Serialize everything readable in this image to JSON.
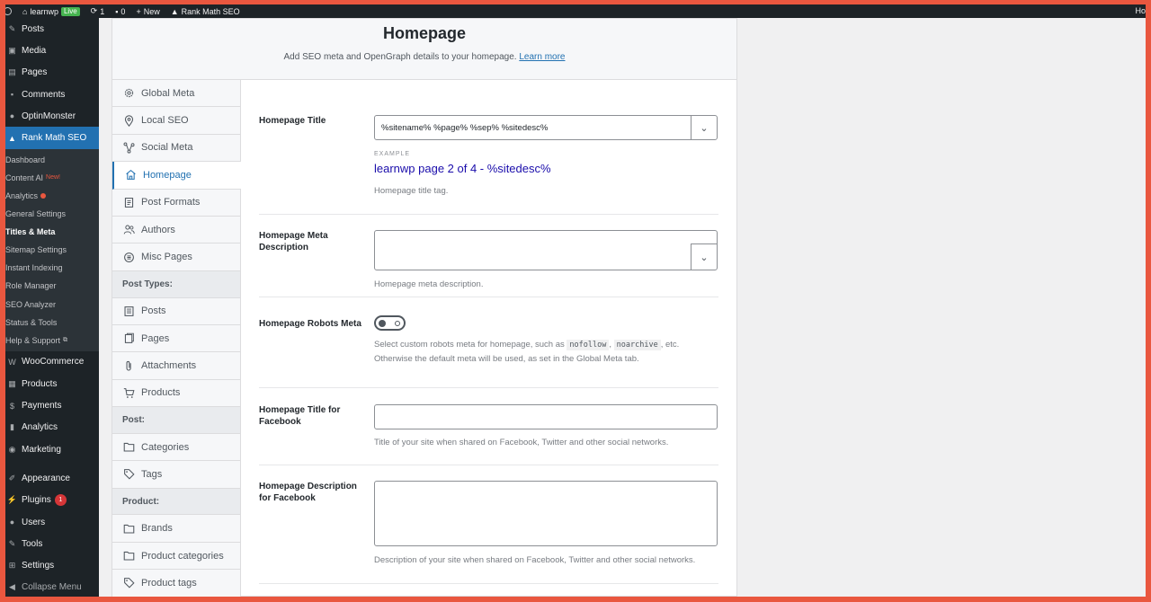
{
  "admin_bar": {
    "site_name": "learnwp",
    "live_badge": "Live",
    "updates_count": "1",
    "comments_count": "0",
    "new_label": "New",
    "plugin_label": "Rank Math SEO",
    "right_text": "Ho"
  },
  "admin_menu": {
    "items_top": [
      {
        "label": "Posts",
        "icon": "pin-icon"
      },
      {
        "label": "Media",
        "icon": "media-icon"
      },
      {
        "label": "Pages",
        "icon": "pages-icon"
      },
      {
        "label": "Comments",
        "icon": "comment-icon"
      },
      {
        "label": "OptinMonster",
        "icon": "optinmonster-icon"
      }
    ],
    "active_item": "Rank Math SEO",
    "submenu": [
      {
        "label": "Dashboard"
      },
      {
        "label": "Content AI",
        "tag": "New!"
      },
      {
        "label": "Analytics"
      },
      {
        "label": "General Settings"
      },
      {
        "label": "Titles & Meta"
      },
      {
        "label": "Sitemap Settings"
      },
      {
        "label": "Instant Indexing"
      },
      {
        "label": "Role Manager"
      },
      {
        "label": "SEO Analyzer"
      },
      {
        "label": "Status & Tools"
      },
      {
        "label": "Help & Support"
      }
    ],
    "items_bottom": [
      {
        "label": "WooCommerce"
      },
      {
        "label": "Products"
      },
      {
        "label": "Payments"
      },
      {
        "label": "Analytics"
      },
      {
        "label": "Marketing"
      }
    ],
    "items_bottom2": [
      {
        "label": "Appearance"
      },
      {
        "label": "Plugins",
        "badge": "1"
      },
      {
        "label": "Users"
      },
      {
        "label": "Tools"
      },
      {
        "label": "Settings"
      },
      {
        "label": "Collapse Menu"
      }
    ]
  },
  "header": {
    "title": "Homepage",
    "subtitle": "Add SEO meta and OpenGraph details to your homepage.",
    "learn_more": "Learn more"
  },
  "tabs": {
    "items": [
      {
        "label": "Global Meta"
      },
      {
        "label": "Local SEO"
      },
      {
        "label": "Social Meta"
      },
      {
        "label": "Homepage"
      },
      {
        "label": "Post Formats"
      },
      {
        "label": "Authors"
      },
      {
        "label": "Misc Pages"
      }
    ],
    "post_types_head": "Post Types:",
    "post_types": [
      {
        "label": "Posts"
      },
      {
        "label": "Pages"
      },
      {
        "label": "Attachments"
      },
      {
        "label": "Products"
      }
    ],
    "post_head": "Post:",
    "post": [
      {
        "label": "Categories"
      },
      {
        "label": "Tags"
      }
    ],
    "product_head": "Product:",
    "product": [
      {
        "label": "Brands"
      },
      {
        "label": "Product categories"
      },
      {
        "label": "Product tags"
      }
    ]
  },
  "form": {
    "title_label": "Homepage Title",
    "title_value": "%sitename% %page% %sep% %sitedesc%",
    "example_label": "EXAMPLE",
    "example_value": "learnwp page 2 of 4 - %sitedesc%",
    "title_desc": "Homepage title tag.",
    "meta_label": "Homepage Meta Description",
    "meta_desc": "Homepage meta description.",
    "robots_label": "Homepage Robots Meta",
    "robots_desc_1": "Select custom robots meta for homepage, such as",
    "robots_code_1": "nofollow",
    "robots_code_2": "noarchive",
    "robots_desc_2": ", etc.",
    "robots_desc_3": "Otherwise the default meta will be used, as set in the Global Meta tab.",
    "fb_title_label": "Homepage Title for Facebook",
    "fb_title_desc": "Title of your site when shared on Facebook, Twitter and other social networks.",
    "fb_desc_label": "Homepage Description for Facebook",
    "fb_desc_desc": "Description of your site when shared on Facebook, Twitter and other social networks."
  }
}
